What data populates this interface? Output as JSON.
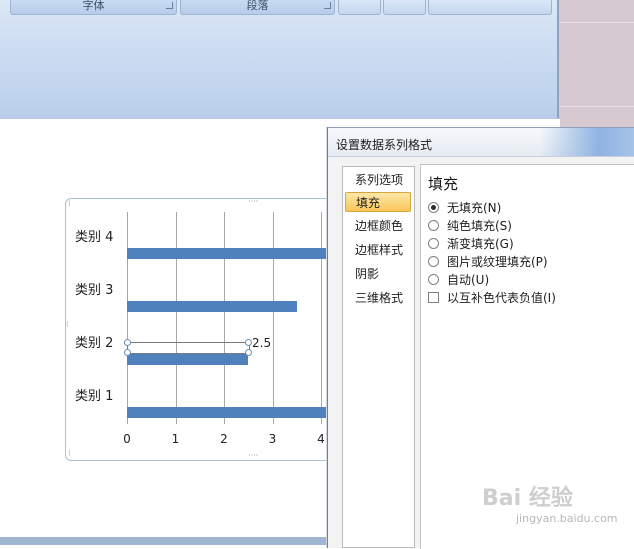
{
  "ribbon": {
    "groups": [
      {
        "label": "字体"
      },
      {
        "label": "段落"
      }
    ]
  },
  "chart": {
    "data_label": "2.5"
  },
  "chart_data": {
    "type": "bar",
    "orientation": "horizontal",
    "categories": [
      "类别 1",
      "类别 2",
      "类别 3",
      "类别 4"
    ],
    "values": [
      4.5,
      2.5,
      3.5,
      4.5
    ],
    "xlim": [
      0,
      5
    ],
    "x_ticks": [
      "0",
      "1",
      "2",
      "3",
      "4"
    ],
    "grid": true,
    "bar_color": "#4f81bd",
    "annotations": [
      {
        "category": "类别 2",
        "text": "2.5"
      }
    ]
  },
  "dialog": {
    "title": "设置数据系列格式",
    "nav_items": [
      {
        "label": "系列选项",
        "active": false
      },
      {
        "label": "填充",
        "active": true
      },
      {
        "label": "边框颜色",
        "active": false
      },
      {
        "label": "边框样式",
        "active": false
      },
      {
        "label": "阴影",
        "active": false
      },
      {
        "label": "三维格式",
        "active": false
      }
    ],
    "section_heading": "填充",
    "options": [
      {
        "label": "无填充(N)",
        "type": "radio",
        "checked": true
      },
      {
        "label": "纯色填充(S)",
        "type": "radio",
        "checked": false
      },
      {
        "label": "渐变填充(G)",
        "type": "radio",
        "checked": false
      },
      {
        "label": "图片或纹理填充(P)",
        "type": "radio",
        "checked": false
      },
      {
        "label": "自动(U)",
        "type": "radio",
        "checked": false
      },
      {
        "label": "以互补色代表负值(I)",
        "type": "checkbox",
        "checked": false
      }
    ]
  },
  "watermark": {
    "text": "Bai 经验",
    "url": "jingyan.baidu.com"
  }
}
